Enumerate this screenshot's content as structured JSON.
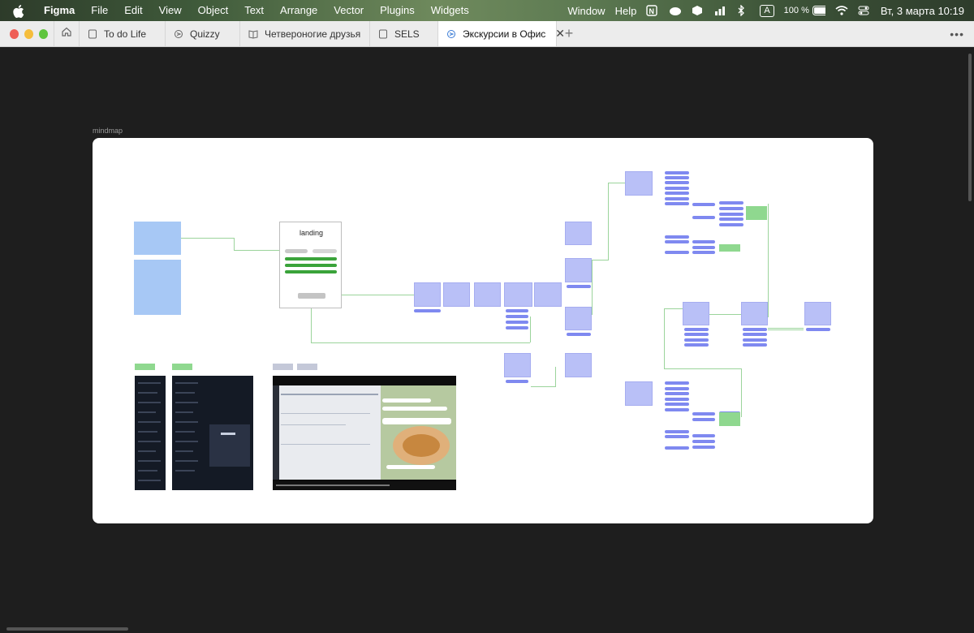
{
  "menubar": {
    "app_name": "Figma",
    "items": [
      "File",
      "Edit",
      "View",
      "Object",
      "Text",
      "Arrange",
      "Vector",
      "Plugins",
      "Widgets"
    ],
    "right_items": [
      "Window",
      "Help"
    ],
    "battery": "100 %",
    "input_source": "A",
    "datetime": "Вт, 3 марта  10:19"
  },
  "tabs": [
    {
      "label": "To do Life",
      "icon": "file-icon"
    },
    {
      "label": "Quizzy",
      "icon": "figjam-icon"
    },
    {
      "label": "Четвероногие друзья",
      "icon": "book-icon"
    },
    {
      "label": "SELS",
      "icon": "file-icon"
    },
    {
      "label": "Экскурсии в Офис",
      "icon": "figjam-icon",
      "active": true
    }
  ],
  "canvas": {
    "frame_label": "mindmap",
    "landing_title": "landing"
  },
  "colors": {
    "canvas_bg": "#1e1e1e",
    "card_blue": "#b9c0f7",
    "note_blue": "#a7c8f5",
    "pill_blue": "#7f89f0",
    "accent_green": "#3aa33a"
  }
}
